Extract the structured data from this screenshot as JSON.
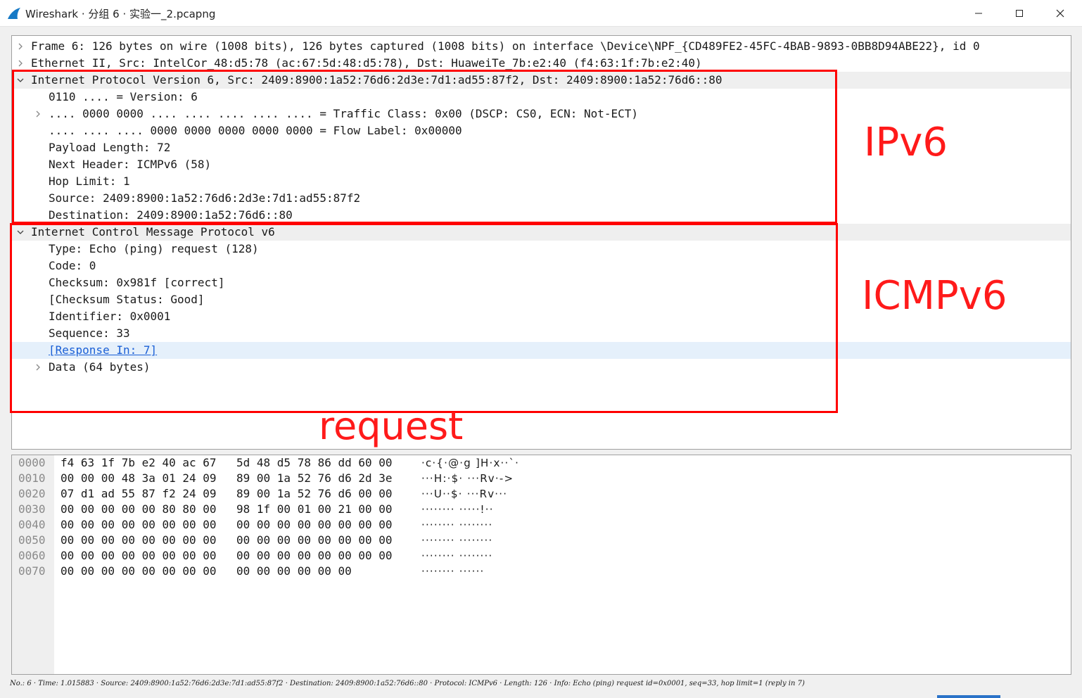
{
  "window": {
    "title": "Wireshark · 分组 6 · 实验一_2.pcapng",
    "controls": {
      "minimize": "minimize-icon",
      "maximize": "maximize-icon",
      "close": "close-icon"
    }
  },
  "details": {
    "rows": [
      {
        "indent": 0,
        "expander": "collapsed",
        "text": "Frame 6: 126 bytes on wire (1008 bits), 126 bytes captured (1008 bits) on interface \\Device\\NPF_{CD489FE2-45FC-4BAB-9893-0BB8D94ABE22}, id 0"
      },
      {
        "indent": 0,
        "expander": "collapsed",
        "text": "Ethernet II, Src: IntelCor_48:d5:78 (ac:67:5d:48:d5:78), Dst: HuaweiTe_7b:e2:40 (f4:63:1f:7b:e2:40)"
      },
      {
        "indent": 0,
        "expander": "expanded",
        "text": "Internet Protocol Version 6, Src: 2409:8900:1a52:76d6:2d3e:7d1:ad55:87f2, Dst: 2409:8900:1a52:76d6::80"
      },
      {
        "indent": 1,
        "expander": "none",
        "text": "0110 .... = Version: 6"
      },
      {
        "indent": 1,
        "expander": "collapsed",
        "text": ".... 0000 0000 .... .... .... .... .... = Traffic Class: 0x00 (DSCP: CS0, ECN: Not-ECT)"
      },
      {
        "indent": 1,
        "expander": "none",
        "text": ".... .... .... 0000 0000 0000 0000 0000 = Flow Label: 0x00000"
      },
      {
        "indent": 1,
        "expander": "none",
        "text": "Payload Length: 72"
      },
      {
        "indent": 1,
        "expander": "none",
        "text": "Next Header: ICMPv6 (58)"
      },
      {
        "indent": 1,
        "expander": "none",
        "text": "Hop Limit: 1"
      },
      {
        "indent": 1,
        "expander": "none",
        "text": "Source: 2409:8900:1a52:76d6:2d3e:7d1:ad55:87f2"
      },
      {
        "indent": 1,
        "expander": "none",
        "text": "Destination: 2409:8900:1a52:76d6::80"
      },
      {
        "indent": 0,
        "expander": "expanded",
        "text": "Internet Control Message Protocol v6"
      },
      {
        "indent": 1,
        "expander": "none",
        "text": "Type: Echo (ping) request (128)"
      },
      {
        "indent": 1,
        "expander": "none",
        "text": "Code: 0"
      },
      {
        "indent": 1,
        "expander": "none",
        "text": "Checksum: 0x981f [correct]"
      },
      {
        "indent": 1,
        "expander": "none",
        "text": "[Checksum Status: Good]"
      },
      {
        "indent": 1,
        "expander": "none",
        "text": "Identifier: 0x0001"
      },
      {
        "indent": 1,
        "expander": "none",
        "text": "Sequence: 33"
      },
      {
        "indent": 1,
        "expander": "none",
        "text": "[Response In: 7]",
        "link": true,
        "selected": true
      },
      {
        "indent": 1,
        "expander": "collapsed",
        "text": "Data (64 bytes)"
      }
    ]
  },
  "annotations": {
    "ipv6_label": "IPv6",
    "icmpv6_label": "ICMPv6",
    "request_label": "request",
    "color": "#ff0000"
  },
  "bytes": {
    "rows": [
      {
        "offset": "0000",
        "hex1": "f4 63 1f 7b e2 40 ac 67",
        "hex2": "5d 48 d5 78 86 dd 60 00",
        "ascii": "·c·{·@·g ]H·x··`·"
      },
      {
        "offset": "0010",
        "hex1": "00 00 00 48 3a 01 24 09",
        "hex2": "89 00 1a 52 76 d6 2d 3e",
        "ascii": "···H:·$· ···Rv·->"
      },
      {
        "offset": "0020",
        "hex1": "07 d1 ad 55 87 f2 24 09",
        "hex2": "89 00 1a 52 76 d6 00 00",
        "ascii": "···U··$· ···Rv···"
      },
      {
        "offset": "0030",
        "hex1": "00 00 00 00 00 80 80 00",
        "hex2": "98 1f 00 01 00 21 00 00",
        "ascii": "········ ·····!··"
      },
      {
        "offset": "0040",
        "hex1": "00 00 00 00 00 00 00 00",
        "hex2": "00 00 00 00 00 00 00 00",
        "ascii": "········ ········"
      },
      {
        "offset": "0050",
        "hex1": "00 00 00 00 00 00 00 00",
        "hex2": "00 00 00 00 00 00 00 00",
        "ascii": "········ ········"
      },
      {
        "offset": "0060",
        "hex1": "00 00 00 00 00 00 00 00",
        "hex2": "00 00 00 00 00 00 00 00",
        "ascii": "········ ········"
      },
      {
        "offset": "0070",
        "hex1": "00 00 00 00 00 00 00 00",
        "hex2": "00 00 00 00 00 00",
        "ascii": "········ ······"
      }
    ]
  },
  "status": {
    "text": "No.: 6 · Time: 1.015883 · Source: 2409:8900:1a52:76d6:2d3e:7d1:ad55:87f2 · Destination: 2409:8900:1a52:76d6::80 · Protocol: ICMPv6 · Length: 126 · Info: Echo (ping) request id=0x0001, seq=33, hop limit=1 (reply in 7)"
  }
}
